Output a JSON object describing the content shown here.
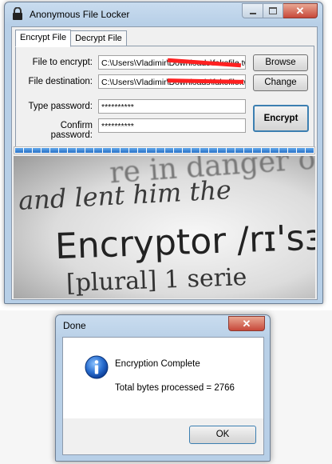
{
  "window": {
    "title": "Anonymous File Locker",
    "caption_close": "✕",
    "tabs": [
      {
        "label": "Encrypt File",
        "active": true
      },
      {
        "label": "Decrypt File",
        "active": false
      }
    ],
    "fields": {
      "file_to_encrypt_label": "File to encrypt:",
      "file_to_encrypt_value": "C:\\Users\\Vladimir\\Downloads\\fakefile.tw",
      "file_destination_label": "File destination:",
      "file_destination_value": "C:\\Users\\Vladimir\\Downloads\\fakefile.tw",
      "type_password_label": "Type password:",
      "type_password_value": "**********",
      "confirm_password_label": "Confirm password:",
      "confirm_password_value": "**********"
    },
    "buttons": {
      "browse": "Browse",
      "change": "Change",
      "encrypt": "Encrypt"
    },
    "progress_fraction": 1.0,
    "banner_lines": [
      "re in danger of",
      "and lent him the",
      "Encryptor /rɪ'sɜː",
      "[plural]  1  serie"
    ]
  },
  "dialog": {
    "title": "Done",
    "close": "✕",
    "line1": "Encryption Complete",
    "line2": "Total bytes processed = 2766",
    "ok": "OK"
  },
  "colors": {
    "title_bar": "#b7cfe7",
    "progress": "#2871c8",
    "close_button": "#c7483a",
    "redaction": "#ff2020"
  }
}
